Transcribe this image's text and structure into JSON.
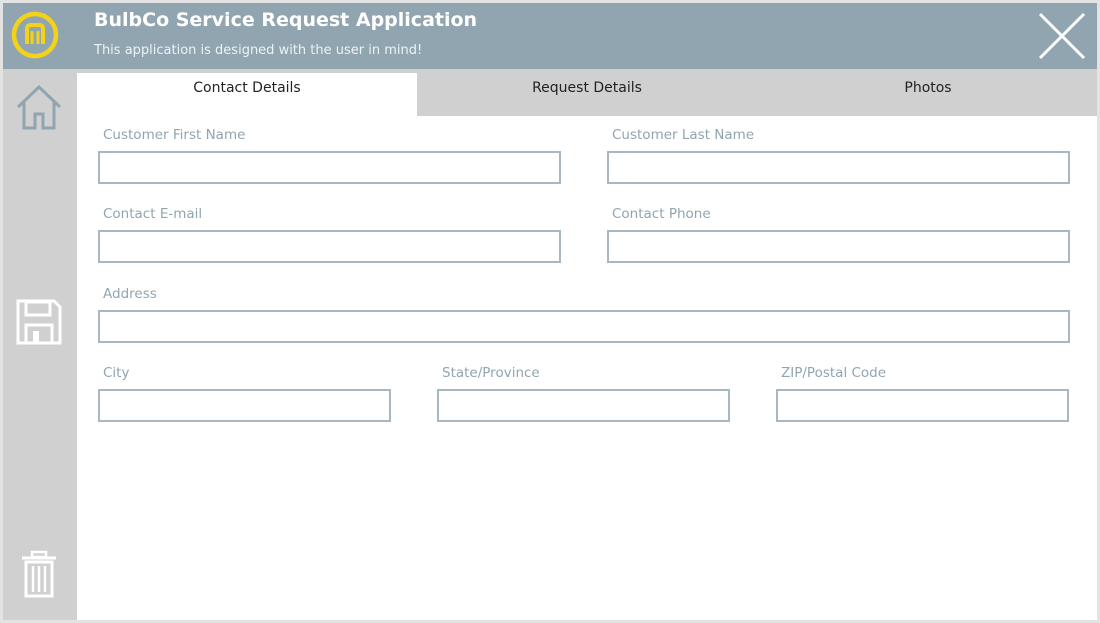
{
  "header": {
    "title": "BulbCo Service Request Application",
    "subtitle": "This application is designed with the user in mind!"
  },
  "icons": {
    "logo": "bulbco-logo-icon",
    "close": "close-icon",
    "home": "home-icon",
    "save": "save-icon",
    "delete": "trash-icon"
  },
  "colors": {
    "header_bg": "#91a5b0",
    "logo_yellow": "#f2d21b",
    "label_text": "#91a5b0",
    "sidebar_bg": "#d0d0d0"
  },
  "tabs": [
    {
      "label": "Contact Details",
      "active": true
    },
    {
      "label": "Request Details",
      "active": false
    },
    {
      "label": "Photos",
      "active": false
    }
  ],
  "form": {
    "first_name": {
      "label": "Customer First Name",
      "value": ""
    },
    "last_name": {
      "label": "Customer Last Name",
      "value": ""
    },
    "email": {
      "label": "Contact E-mail",
      "value": ""
    },
    "phone": {
      "label": "Contact Phone",
      "value": ""
    },
    "address": {
      "label": "Address",
      "value": ""
    },
    "city": {
      "label": "City",
      "value": ""
    },
    "state": {
      "label": "State/Province",
      "value": ""
    },
    "zip": {
      "label": "ZIP/Postal Code",
      "value": ""
    }
  }
}
